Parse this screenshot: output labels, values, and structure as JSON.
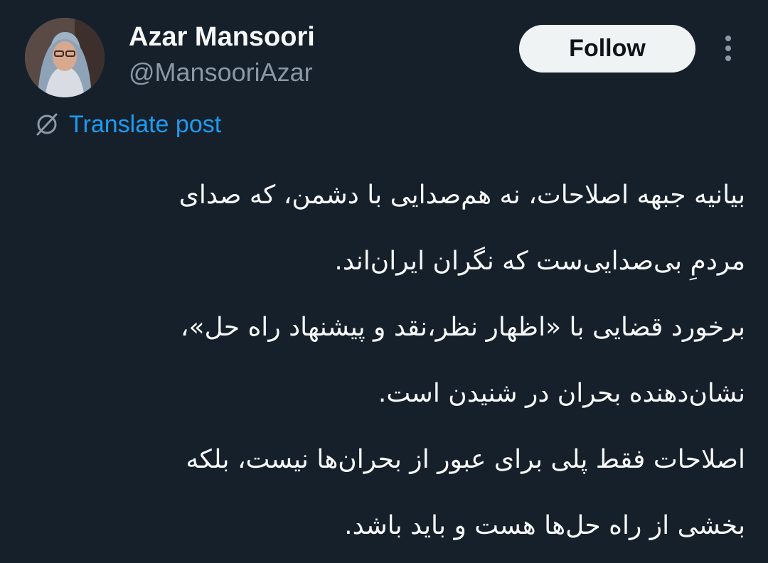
{
  "author": {
    "display_name": "Azar Mansoori",
    "handle": "@MansooriAzar"
  },
  "actions": {
    "follow_label": "Follow",
    "more_icon": "more-vertical-icon"
  },
  "translate": {
    "icon": "translate-icon",
    "label": "Translate post"
  },
  "post": {
    "lines": [
      "بیانیه جبهه اصلاحات، نه هم‌صدایی با دشمن، که صدای",
      "مردمِ بی‌صدایی‌ست که نگران ایران‌اند.",
      "برخورد قضایی با «اظهار نظر،نقد و پیشنهاد راه حل»،",
      "نشان‌دهنده بحران در شنیدن است.",
      "اصلاحات فقط پلی برای عبور از بحران‌ها نیست، بلکه",
      "بخشی از راه حل‌ها هست و باید باشد."
    ]
  },
  "colors": {
    "background": "#15202b",
    "text": "#f7f9f9",
    "secondary_text": "#8b98a5",
    "link": "#1d9bf0",
    "follow_bg": "#eff3f4"
  }
}
